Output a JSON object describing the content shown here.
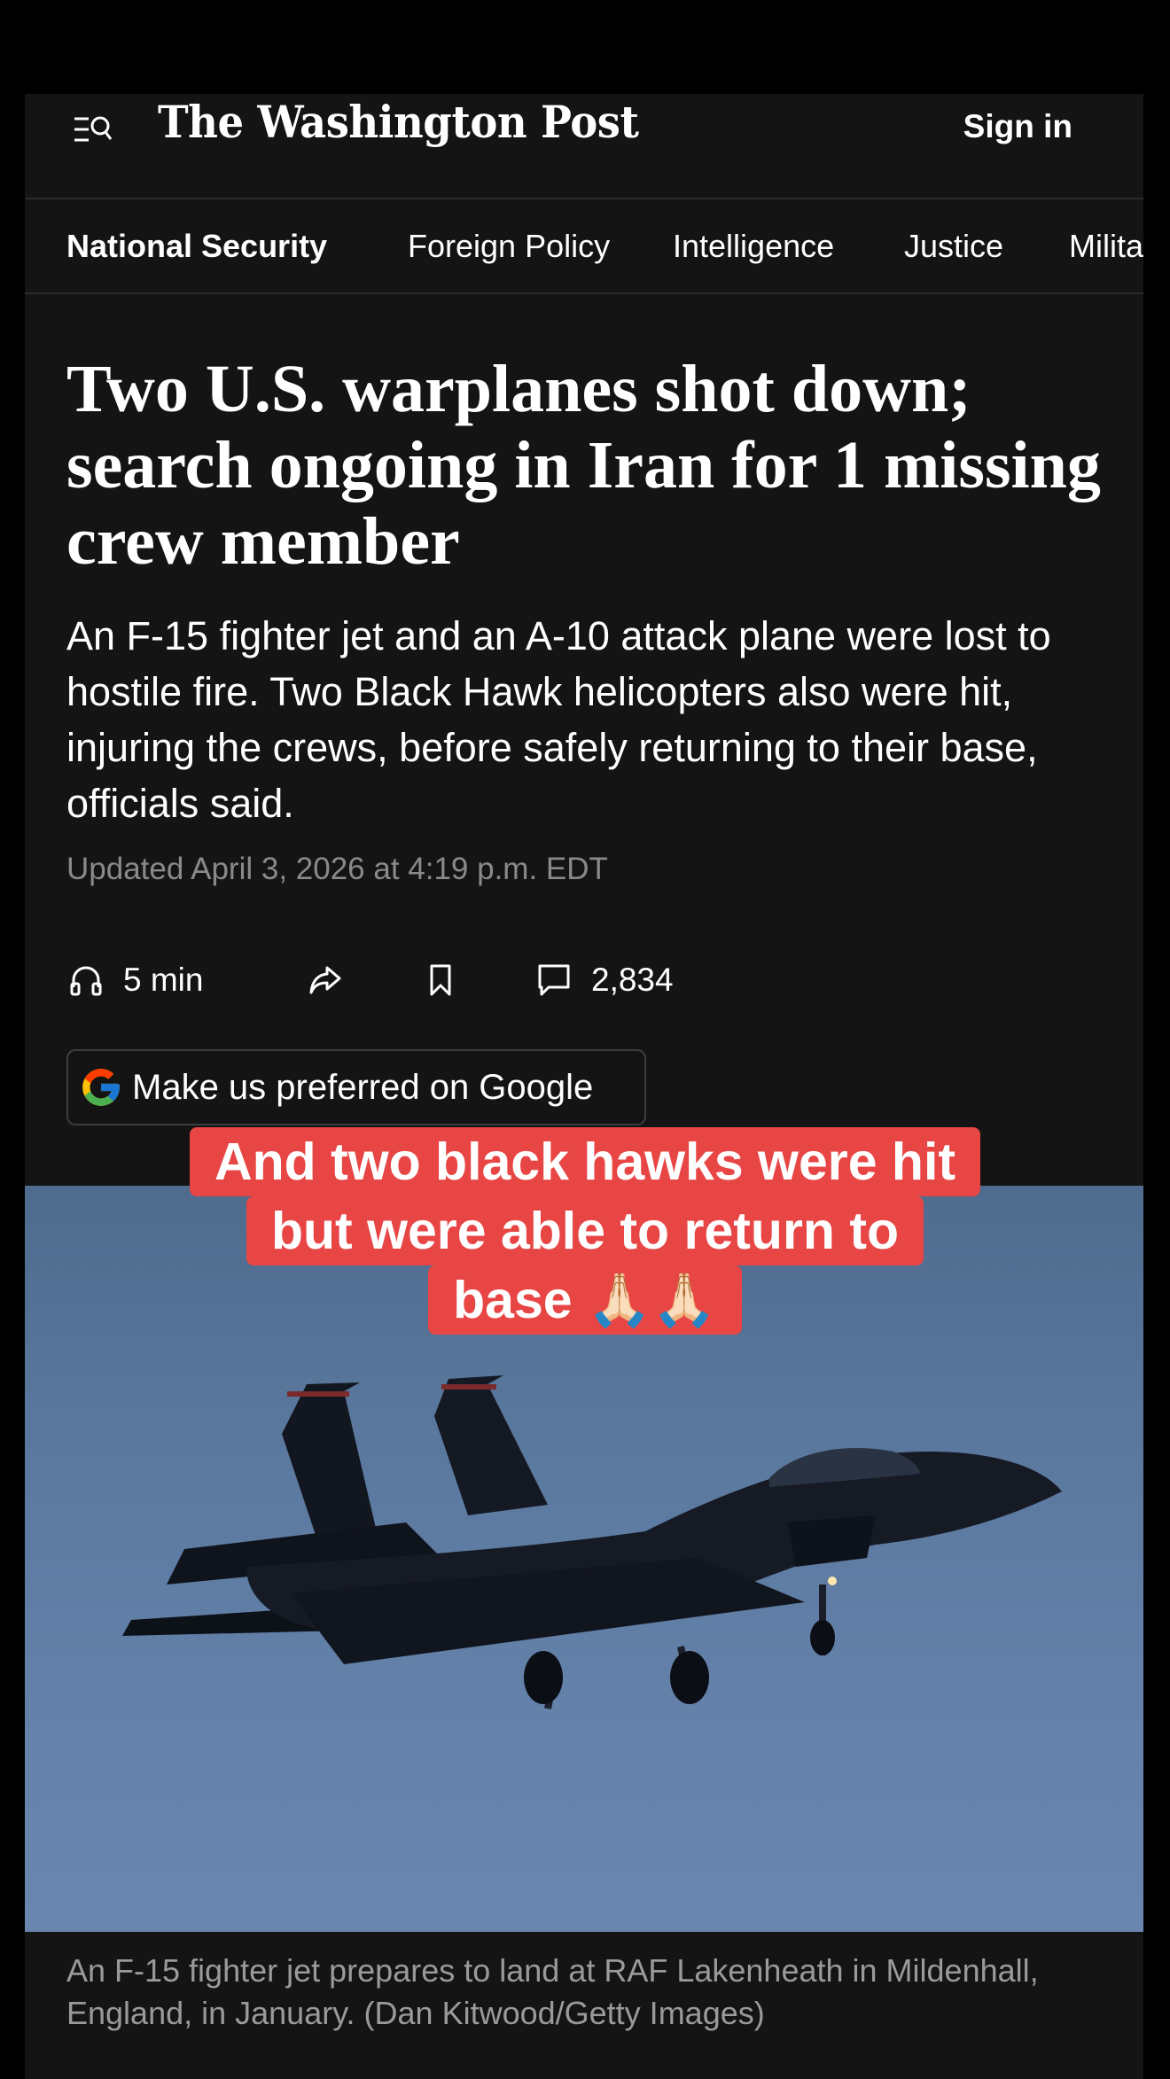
{
  "header": {
    "logo": "The Washington Post",
    "sign_in": "Sign in"
  },
  "sections": [
    "National Security",
    "Foreign Policy",
    "Intelligence",
    "Justice",
    "Military"
  ],
  "article": {
    "headline": "Two U.S. warplanes shot down; search ongoing in Iran for 1 missing crew member",
    "dek": "An F-15 fighter jet and an A-10 attack plane were lost to hostile fire. Two Black Hawk helicopters also were hit, injuring the crews, before safely returning to their base, officials said.",
    "updated": "Updated April 3, 2026 at 4:19 p.m. EDT",
    "listen_time": "5 min",
    "comment_count": "2,834",
    "google_button": "Make us preferred on Google",
    "caption": "An F-15 fighter jet prepares to land at RAF Lakenheath in Mildenhall, England, in January. (Dan Kitwood/Getty Images)"
  },
  "overlay": {
    "line1": "And two black hawks were hit",
    "line2": "but were able to return to",
    "line3": "base 🙏🏻🙏🏻"
  },
  "icons": {
    "menu": "menu-search-icon",
    "listen": "headphones-icon",
    "share": "share-icon",
    "save": "bookmark-icon",
    "comments": "comment-icon",
    "google": "google-logo-icon"
  },
  "colors": {
    "page_bg": "#141414",
    "overlay_bg": "#e84545",
    "sky": "#5c7aa0"
  }
}
